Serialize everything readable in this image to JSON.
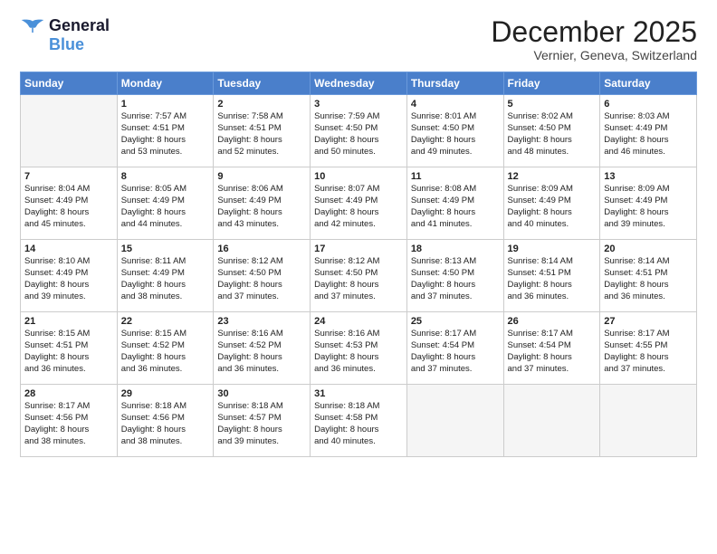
{
  "header": {
    "logo_line1": "General",
    "logo_line2": "Blue",
    "month": "December 2025",
    "location": "Vernier, Geneva, Switzerland"
  },
  "weekdays": [
    "Sunday",
    "Monday",
    "Tuesday",
    "Wednesday",
    "Thursday",
    "Friday",
    "Saturday"
  ],
  "weeks": [
    [
      {
        "day": "",
        "sunrise": "",
        "sunset": "",
        "daylight": ""
      },
      {
        "day": "1",
        "sunrise": "Sunrise: 7:57 AM",
        "sunset": "Sunset: 4:51 PM",
        "daylight": "Daylight: 8 hours and 53 minutes."
      },
      {
        "day": "2",
        "sunrise": "Sunrise: 7:58 AM",
        "sunset": "Sunset: 4:51 PM",
        "daylight": "Daylight: 8 hours and 52 minutes."
      },
      {
        "day": "3",
        "sunrise": "Sunrise: 7:59 AM",
        "sunset": "Sunset: 4:50 PM",
        "daylight": "Daylight: 8 hours and 50 minutes."
      },
      {
        "day": "4",
        "sunrise": "Sunrise: 8:01 AM",
        "sunset": "Sunset: 4:50 PM",
        "daylight": "Daylight: 8 hours and 49 minutes."
      },
      {
        "day": "5",
        "sunrise": "Sunrise: 8:02 AM",
        "sunset": "Sunset: 4:50 PM",
        "daylight": "Daylight: 8 hours and 48 minutes."
      },
      {
        "day": "6",
        "sunrise": "Sunrise: 8:03 AM",
        "sunset": "Sunset: 4:49 PM",
        "daylight": "Daylight: 8 hours and 46 minutes."
      }
    ],
    [
      {
        "day": "7",
        "sunrise": "Sunrise: 8:04 AM",
        "sunset": "Sunset: 4:49 PM",
        "daylight": "Daylight: 8 hours and 45 minutes."
      },
      {
        "day": "8",
        "sunrise": "Sunrise: 8:05 AM",
        "sunset": "Sunset: 4:49 PM",
        "daylight": "Daylight: 8 hours and 44 minutes."
      },
      {
        "day": "9",
        "sunrise": "Sunrise: 8:06 AM",
        "sunset": "Sunset: 4:49 PM",
        "daylight": "Daylight: 8 hours and 43 minutes."
      },
      {
        "day": "10",
        "sunrise": "Sunrise: 8:07 AM",
        "sunset": "Sunset: 4:49 PM",
        "daylight": "Daylight: 8 hours and 42 minutes."
      },
      {
        "day": "11",
        "sunrise": "Sunrise: 8:08 AM",
        "sunset": "Sunset: 4:49 PM",
        "daylight": "Daylight: 8 hours and 41 minutes."
      },
      {
        "day": "12",
        "sunrise": "Sunrise: 8:09 AM",
        "sunset": "Sunset: 4:49 PM",
        "daylight": "Daylight: 8 hours and 40 minutes."
      },
      {
        "day": "13",
        "sunrise": "Sunrise: 8:09 AM",
        "sunset": "Sunset: 4:49 PM",
        "daylight": "Daylight: 8 hours and 39 minutes."
      }
    ],
    [
      {
        "day": "14",
        "sunrise": "Sunrise: 8:10 AM",
        "sunset": "Sunset: 4:49 PM",
        "daylight": "Daylight: 8 hours and 39 minutes."
      },
      {
        "day": "15",
        "sunrise": "Sunrise: 8:11 AM",
        "sunset": "Sunset: 4:49 PM",
        "daylight": "Daylight: 8 hours and 38 minutes."
      },
      {
        "day": "16",
        "sunrise": "Sunrise: 8:12 AM",
        "sunset": "Sunset: 4:50 PM",
        "daylight": "Daylight: 8 hours and 37 minutes."
      },
      {
        "day": "17",
        "sunrise": "Sunrise: 8:12 AM",
        "sunset": "Sunset: 4:50 PM",
        "daylight": "Daylight: 8 hours and 37 minutes."
      },
      {
        "day": "18",
        "sunrise": "Sunrise: 8:13 AM",
        "sunset": "Sunset: 4:50 PM",
        "daylight": "Daylight: 8 hours and 37 minutes."
      },
      {
        "day": "19",
        "sunrise": "Sunrise: 8:14 AM",
        "sunset": "Sunset: 4:51 PM",
        "daylight": "Daylight: 8 hours and 36 minutes."
      },
      {
        "day": "20",
        "sunrise": "Sunrise: 8:14 AM",
        "sunset": "Sunset: 4:51 PM",
        "daylight": "Daylight: 8 hours and 36 minutes."
      }
    ],
    [
      {
        "day": "21",
        "sunrise": "Sunrise: 8:15 AM",
        "sunset": "Sunset: 4:51 PM",
        "daylight": "Daylight: 8 hours and 36 minutes."
      },
      {
        "day": "22",
        "sunrise": "Sunrise: 8:15 AM",
        "sunset": "Sunset: 4:52 PM",
        "daylight": "Daylight: 8 hours and 36 minutes."
      },
      {
        "day": "23",
        "sunrise": "Sunrise: 8:16 AM",
        "sunset": "Sunset: 4:52 PM",
        "daylight": "Daylight: 8 hours and 36 minutes."
      },
      {
        "day": "24",
        "sunrise": "Sunrise: 8:16 AM",
        "sunset": "Sunset: 4:53 PM",
        "daylight": "Daylight: 8 hours and 36 minutes."
      },
      {
        "day": "25",
        "sunrise": "Sunrise: 8:17 AM",
        "sunset": "Sunset: 4:54 PM",
        "daylight": "Daylight: 8 hours and 37 minutes."
      },
      {
        "day": "26",
        "sunrise": "Sunrise: 8:17 AM",
        "sunset": "Sunset: 4:54 PM",
        "daylight": "Daylight: 8 hours and 37 minutes."
      },
      {
        "day": "27",
        "sunrise": "Sunrise: 8:17 AM",
        "sunset": "Sunset: 4:55 PM",
        "daylight": "Daylight: 8 hours and 37 minutes."
      }
    ],
    [
      {
        "day": "28",
        "sunrise": "Sunrise: 8:17 AM",
        "sunset": "Sunset: 4:56 PM",
        "daylight": "Daylight: 8 hours and 38 minutes."
      },
      {
        "day": "29",
        "sunrise": "Sunrise: 8:18 AM",
        "sunset": "Sunset: 4:56 PM",
        "daylight": "Daylight: 8 hours and 38 minutes."
      },
      {
        "day": "30",
        "sunrise": "Sunrise: 8:18 AM",
        "sunset": "Sunset: 4:57 PM",
        "daylight": "Daylight: 8 hours and 39 minutes."
      },
      {
        "day": "31",
        "sunrise": "Sunrise: 8:18 AM",
        "sunset": "Sunset: 4:58 PM",
        "daylight": "Daylight: 8 hours and 40 minutes."
      },
      {
        "day": "",
        "sunrise": "",
        "sunset": "",
        "daylight": ""
      },
      {
        "day": "",
        "sunrise": "",
        "sunset": "",
        "daylight": ""
      },
      {
        "day": "",
        "sunrise": "",
        "sunset": "",
        "daylight": ""
      }
    ]
  ]
}
